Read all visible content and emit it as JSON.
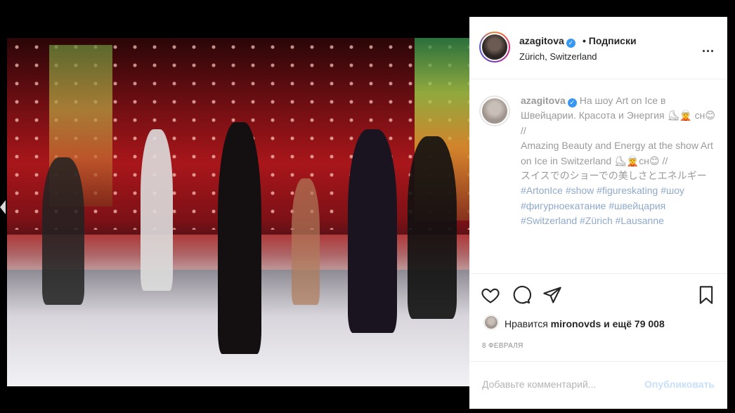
{
  "header": {
    "username": "azagitova",
    "follow_label": "• Подписки",
    "location": "Zürich, Switzerland",
    "more_label": "..."
  },
  "caption": {
    "username": "azagitova",
    "line_ru": "На шоу Art on Ice в Швейцарии. Красота и Энергия ⛸🧝 сн😊 //",
    "line_en": "Amazing Beauty and Energy at the show Art on Ice in Switzerland ⛸🧝сн😊 //",
    "line_jp": "スイスでのショーでの美しさとエネルギー",
    "hashtags": "#ArtonIce #show #figureskating #шоу #фигурноекатание #швейцария #Switzerland #Zürich #Lausanne"
  },
  "likes": {
    "prefix": "Нравится",
    "user": "mironovds",
    "suffix": "и ещё 79 008"
  },
  "date": "8 ФЕВРАЛЯ",
  "comment": {
    "placeholder": "Добавьте комментарий...",
    "publish_label": "Опубликовать"
  },
  "icons": [
    "heart-icon",
    "comment-icon",
    "share-icon",
    "bookmark-icon",
    "verified-icon",
    "more-icon",
    "chevron-left-icon"
  ]
}
